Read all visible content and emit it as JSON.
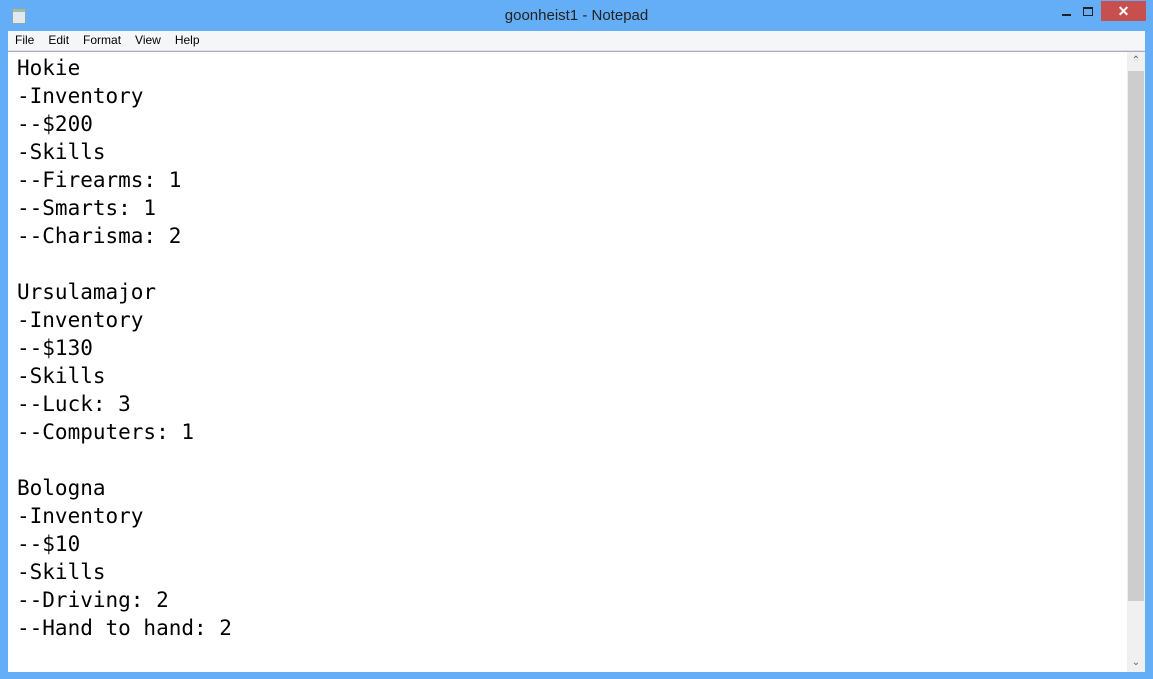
{
  "window": {
    "title": "goonheist1 - Notepad",
    "minimize": "",
    "maximize": "",
    "close": "✕"
  },
  "menu": [
    "File",
    "Edit",
    "Format",
    "View",
    "Help"
  ],
  "content": "Hokie\n-Inventory\n--$200\n-Skills\n--Firearms: 1\n--Smarts: 1\n--Charisma: 2\n\nUrsulamajor\n-Inventory\n--$130\n-Skills\n--Luck: 3\n--Computers: 1\n\nBologna\n-Inventory\n--$10\n-Skills\n--Driving: 2\n--Hand to hand: 2",
  "scrollbar": {
    "up": "⌃",
    "down": "⌄"
  }
}
